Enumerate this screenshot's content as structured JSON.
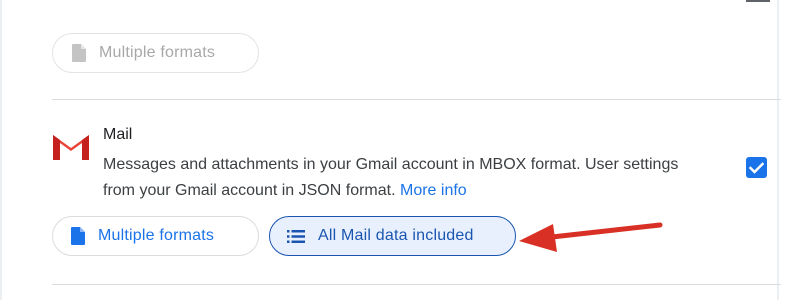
{
  "previous_service": {
    "formats_chip": {
      "label": "Multiple formats",
      "icon": "document-icon",
      "state": "disabled"
    }
  },
  "mail_service": {
    "name": "Mail",
    "logo": "gmail-logo",
    "description": "Messages and attachments in your Gmail account in MBOX format. User settings from your Gmail account in JSON format.",
    "more_info_label": "More info",
    "selected": true,
    "formats_chip": {
      "label": "Multiple formats",
      "icon": "document-icon"
    },
    "data_chip": {
      "label": "All Mail data included",
      "icon": "list-icon"
    }
  },
  "annotation": {
    "type": "arrow",
    "color": "#d93025",
    "points_to": "data_chip"
  },
  "colors": {
    "accent": "#1a73e8",
    "selected_chip_bg": "#e8f0fe",
    "gmail_red": "#ea4335",
    "arrow_red": "#d93025"
  }
}
